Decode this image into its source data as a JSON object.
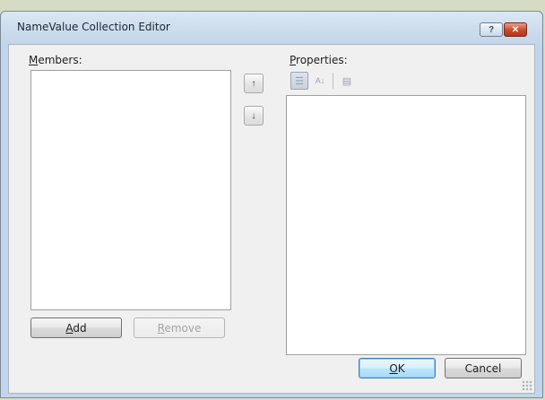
{
  "window": {
    "title": "NameValue Collection Editor",
    "help_label": "?",
    "close_label": "✕"
  },
  "members": {
    "label": "Members:",
    "items": []
  },
  "move": {
    "up_glyph": "↑",
    "down_glyph": "↓"
  },
  "properties": {
    "label": "Properties:",
    "toolbar": {
      "categorized_glyph": "☰",
      "alphabetical_glyph": "A↓",
      "property_pages_glyph": "▤"
    },
    "items": []
  },
  "buttons": {
    "add": "Add",
    "remove": "Remove",
    "ok": "OK",
    "cancel": "Cancel"
  },
  "colors": {
    "accent": "#3c7fb1",
    "close": "#c9492b"
  },
  "icons": {
    "help": "help-icon",
    "close": "close-icon",
    "move_up": "arrow-up-icon",
    "move_down": "arrow-down-icon",
    "categorized": "categorized-icon",
    "alphabetical": "sort-alphabetical-icon",
    "property_pages": "property-pages-icon"
  }
}
